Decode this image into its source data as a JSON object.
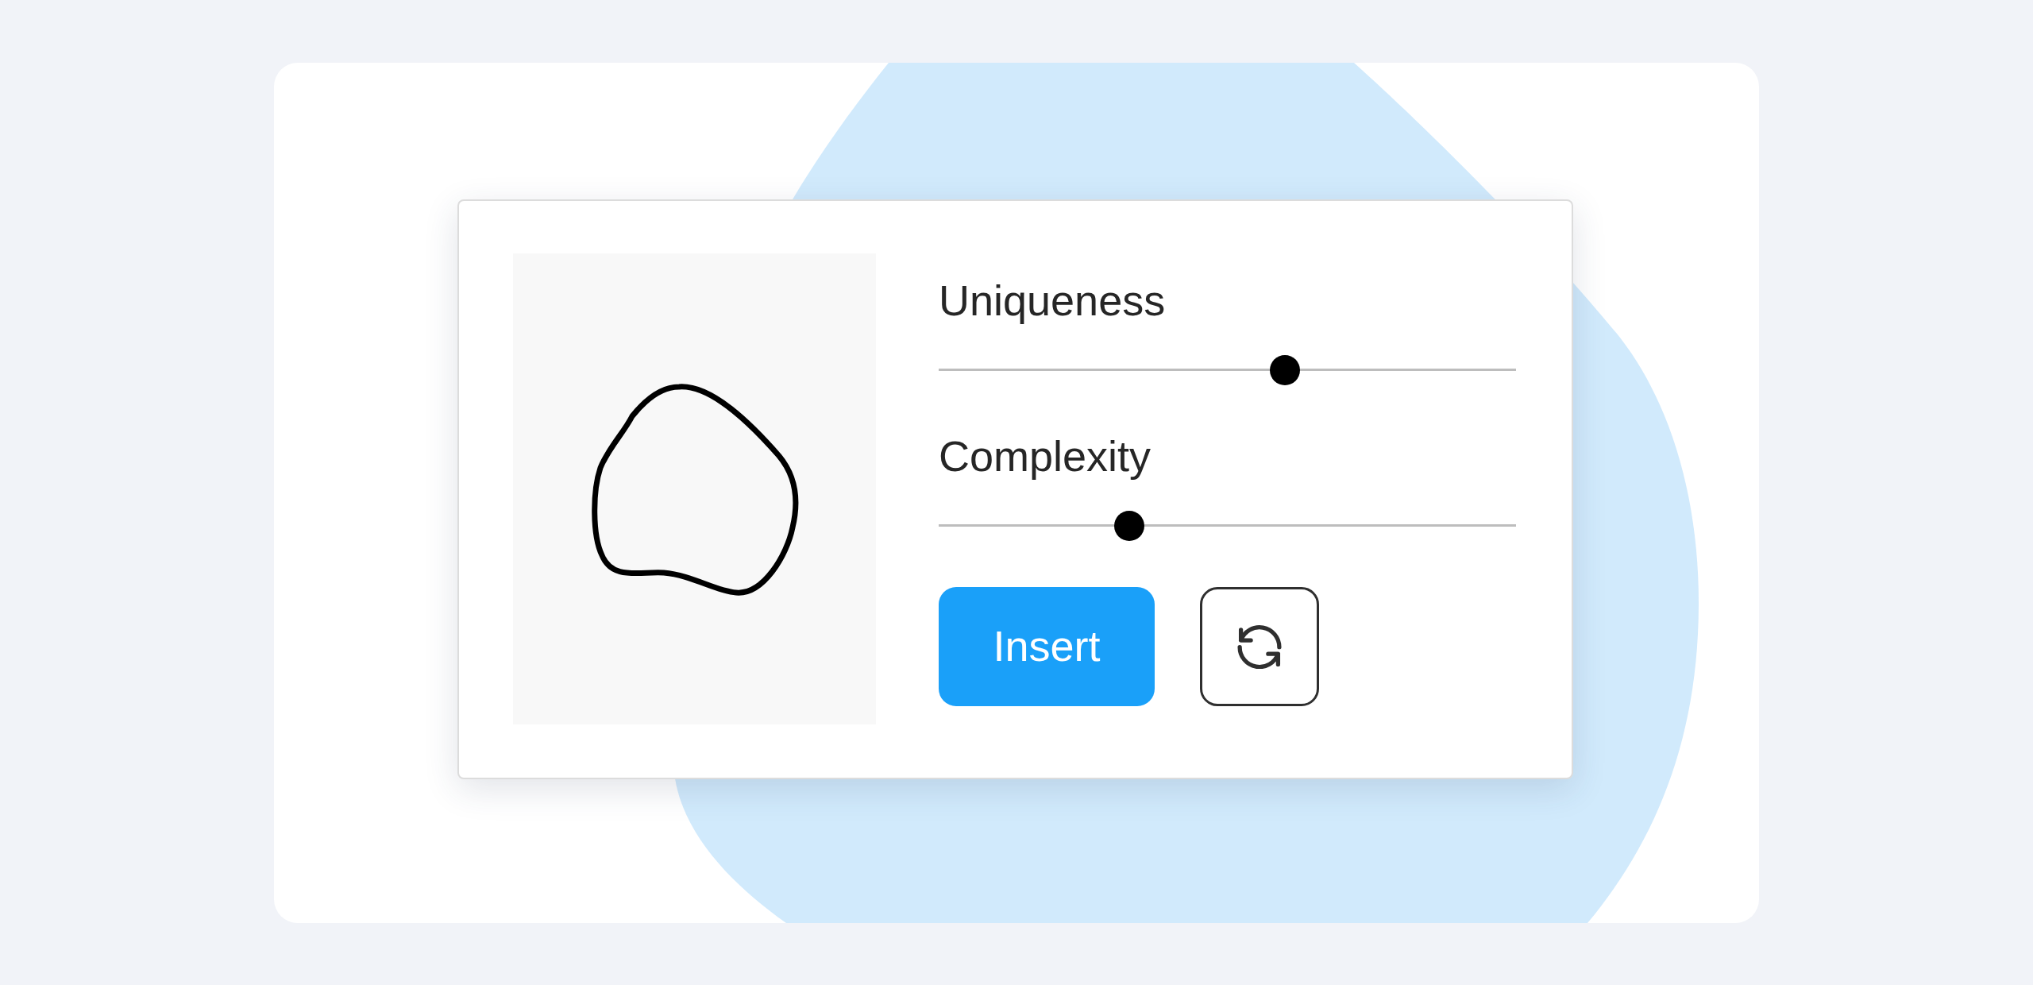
{
  "sliders": [
    {
      "label": "Uniqueness",
      "level": 0.6
    },
    {
      "label": "Complexity",
      "level": 0.33
    }
  ],
  "buttons": [
    {
      "kind": "primary",
      "label": "Insert"
    },
    {
      "kind": "refresh"
    }
  ]
}
